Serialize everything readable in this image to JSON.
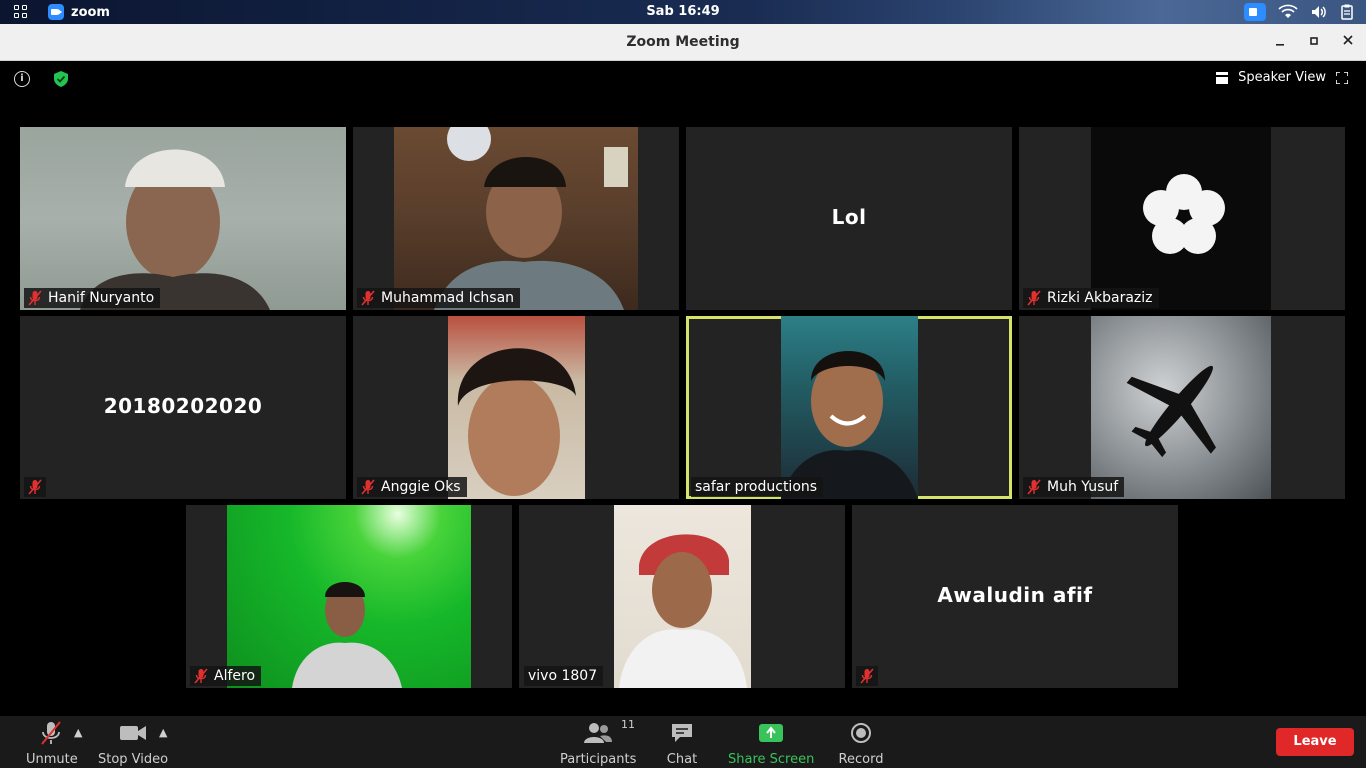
{
  "system_bar": {
    "app_name": "zoom",
    "clock": "Sab 16:49"
  },
  "window": {
    "title": "Zoom Meeting"
  },
  "meeting": {
    "view_label": "Speaker View",
    "tiles": [
      {
        "name": "Hanif Nuryanto",
        "muted": true,
        "video": true
      },
      {
        "name": "Muhammad Ichsan",
        "muted": true,
        "video": true
      },
      {
        "name": "",
        "display_text": "Lol",
        "muted": false,
        "video": false
      },
      {
        "name": "Rizki Akbaraziz",
        "muted": true,
        "video": true
      },
      {
        "name": "",
        "display_text": "20180202020",
        "muted": true,
        "video": false
      },
      {
        "name": "Anggie Oks",
        "muted": true,
        "video": true
      },
      {
        "name": "safar productions",
        "muted": false,
        "video": true,
        "active_speaker": true
      },
      {
        "name": "Muh Yusuf",
        "muted": true,
        "video": true
      },
      {
        "name": "Alfero",
        "muted": true,
        "video": true
      },
      {
        "name": "vivo 1807",
        "muted": false,
        "video": true
      },
      {
        "name": "",
        "display_text": "Awaludin afif",
        "muted": true,
        "video": false
      }
    ]
  },
  "toolbar": {
    "unmute_label": "Unmute",
    "stop_video_label": "Stop Video",
    "participants_label": "Participants",
    "participants_count": "11",
    "chat_label": "Chat",
    "share_label": "Share Screen",
    "record_label": "Record",
    "leave_label": "Leave"
  },
  "colors": {
    "active_speaker_border": "#d6e36a",
    "share_green": "#39c35b",
    "leave_red": "#e02828",
    "zoom_blue": "#2d8cff"
  }
}
